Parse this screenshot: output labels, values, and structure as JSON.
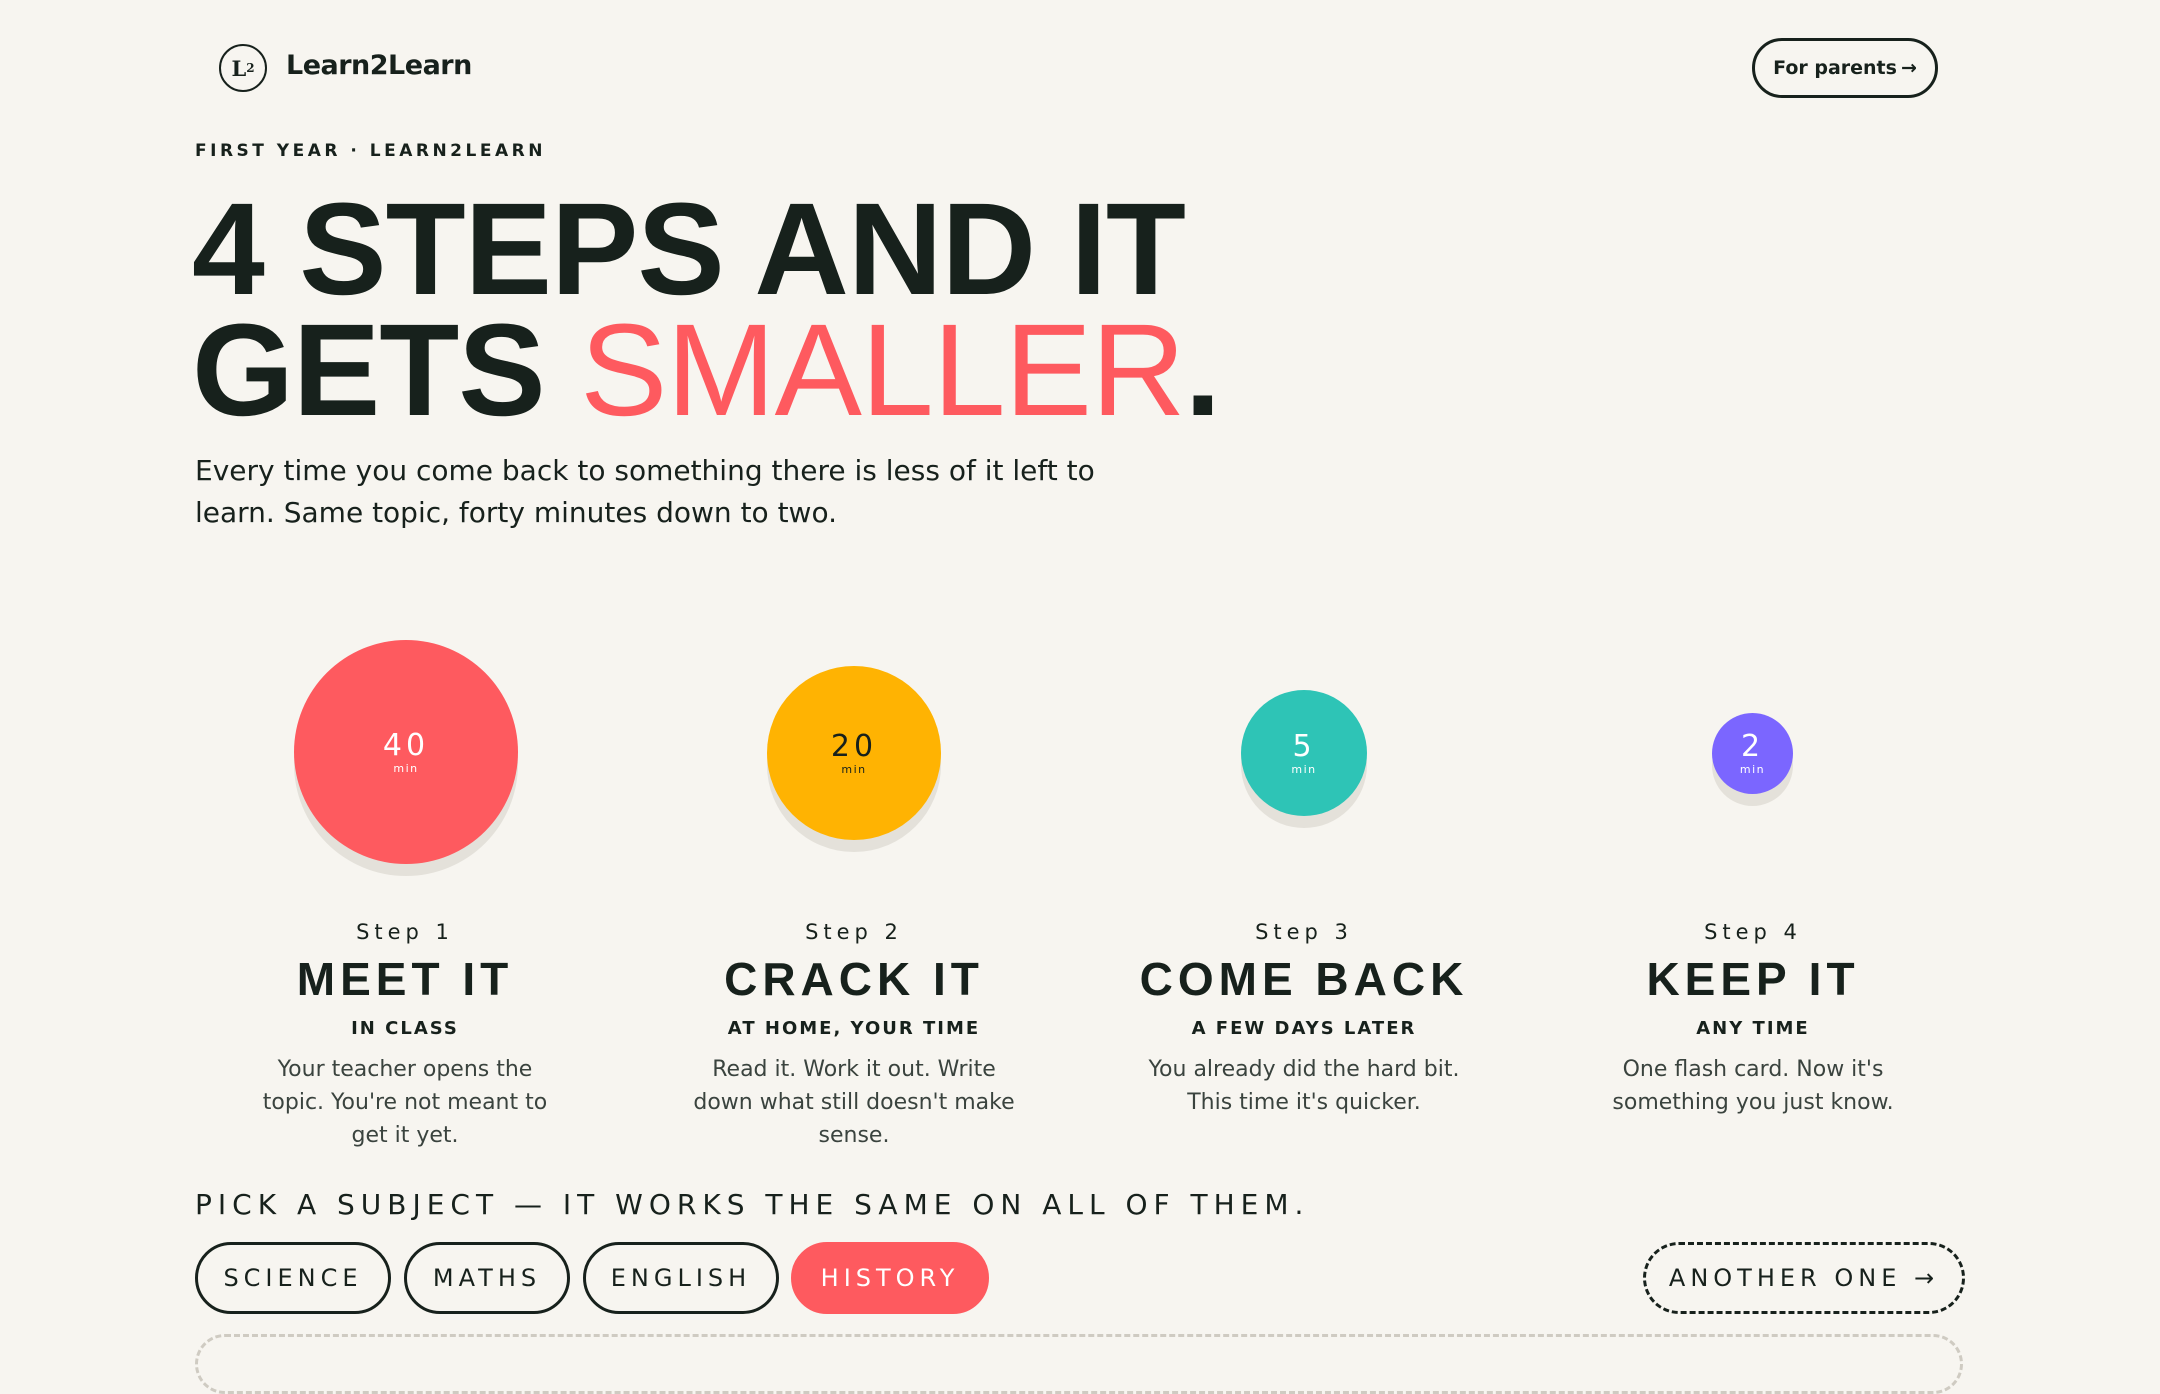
{
  "brand": {
    "mark": "L",
    "mark_sup": "2",
    "name": "Learn2Learn"
  },
  "nav": {
    "parents_label": "For parents",
    "parents_icon": "arrow-right-icon"
  },
  "hero": {
    "eyebrow": "FIRST YEAR · LEARN2LEARN",
    "line1": "4 STEPS AND IT",
    "line2_start": "GETS ",
    "line2_accent": "SMALLER",
    "line2_end": ".",
    "lead": "Every time you come back to something there is less of it left to learn. Same topic, forty minutes down to two."
  },
  "steps": [
    {
      "minutes": "40",
      "unit": "min",
      "color": "#fe5a5f",
      "text_color": "#ffffff",
      "label": "Step 1",
      "title": "MEET IT",
      "when": "IN CLASS",
      "desc": "Your teacher opens the topic. You're not meant to get it yet."
    },
    {
      "minutes": "20",
      "unit": "min",
      "color": "#ffb302",
      "text_color": "#17211c",
      "label": "Step 2",
      "title": "CRACK IT",
      "when": "AT HOME, YOUR TIME",
      "desc": "Read it. Work it out. Write down what still doesn't make sense."
    },
    {
      "minutes": "5",
      "unit": "min",
      "color": "#2ec4b6",
      "text_color": "#ffffff",
      "label": "Step 3",
      "title": "COME BACK",
      "when": "A FEW DAYS LATER",
      "desc": "You already did the hard bit. This time it's quicker."
    },
    {
      "minutes": "2",
      "unit": "min",
      "color": "#7b66ff",
      "text_color": "#ffffff",
      "label": "Step 4",
      "title": "KEEP IT",
      "when": "ANY TIME",
      "desc": "One flash card. Now it's something you just know."
    }
  ],
  "subjects": {
    "prompt": "PICK A SUBJECT — IT WORKS THE SAME ON ALL OF THEM.",
    "chips": [
      "SCIENCE",
      "MATHS",
      "ENGLISH",
      "HISTORY"
    ],
    "active": "HISTORY",
    "another": "ANOTHER ONE →"
  }
}
